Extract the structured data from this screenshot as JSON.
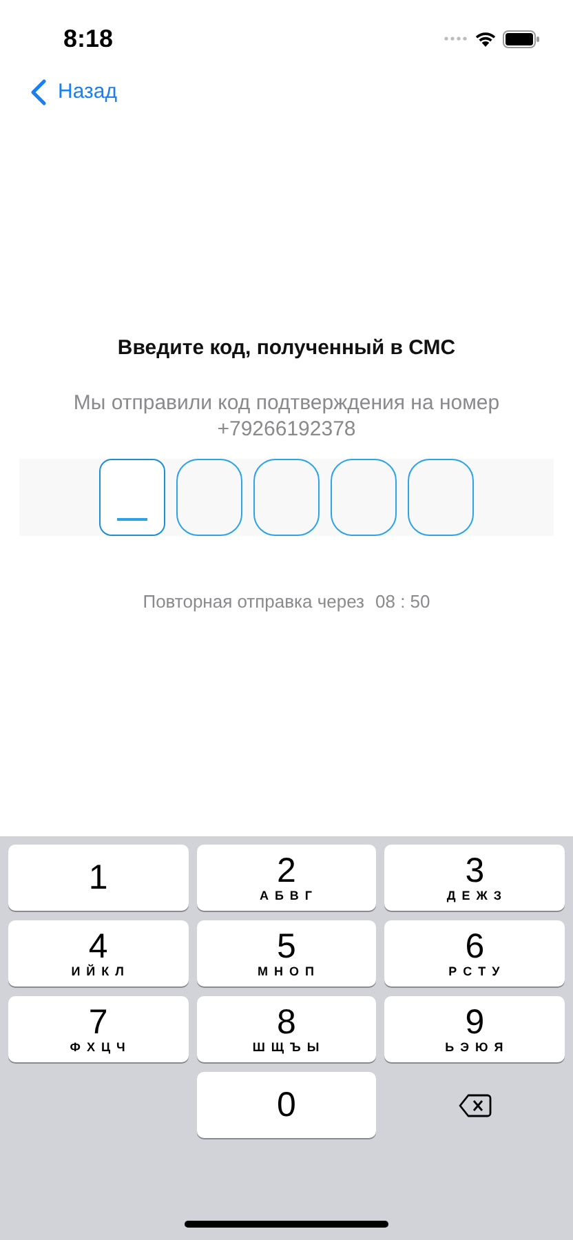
{
  "status_bar": {
    "time": "8:18"
  },
  "nav": {
    "back_label": "Назад"
  },
  "title": "Введите код, полученный в СМС",
  "subtitle": "Мы отправили код подтверждения на номер +79266192378",
  "code_cells": [
    {
      "selected": true
    },
    {
      "selected": false
    },
    {
      "selected": false
    },
    {
      "selected": false
    },
    {
      "selected": false
    }
  ],
  "resend": {
    "label": "Повторная отправка через",
    "timer": "08 : 50"
  },
  "keypad": [
    {
      "kind": "digit",
      "digit": "1"
    },
    {
      "kind": "digit",
      "digit": "2",
      "letters": "А Б В Г"
    },
    {
      "kind": "digit",
      "digit": "3",
      "letters": "Д Е Ж З"
    },
    {
      "kind": "digit",
      "digit": "4",
      "letters": "И Й К Л"
    },
    {
      "kind": "digit",
      "digit": "5",
      "letters": "М Н О П"
    },
    {
      "kind": "digit",
      "digit": "6",
      "letters": "Р С Т У"
    },
    {
      "kind": "digit",
      "digit": "7",
      "letters": "Ф Х Ц Ч"
    },
    {
      "kind": "digit",
      "digit": "8",
      "letters": "Ш Щ Ъ Ы"
    },
    {
      "kind": "digit",
      "digit": "9",
      "letters": "Ь Э Ю Я"
    },
    {
      "kind": "empty"
    },
    {
      "kind": "digit",
      "digit": "0"
    },
    {
      "kind": "backspace"
    }
  ]
}
